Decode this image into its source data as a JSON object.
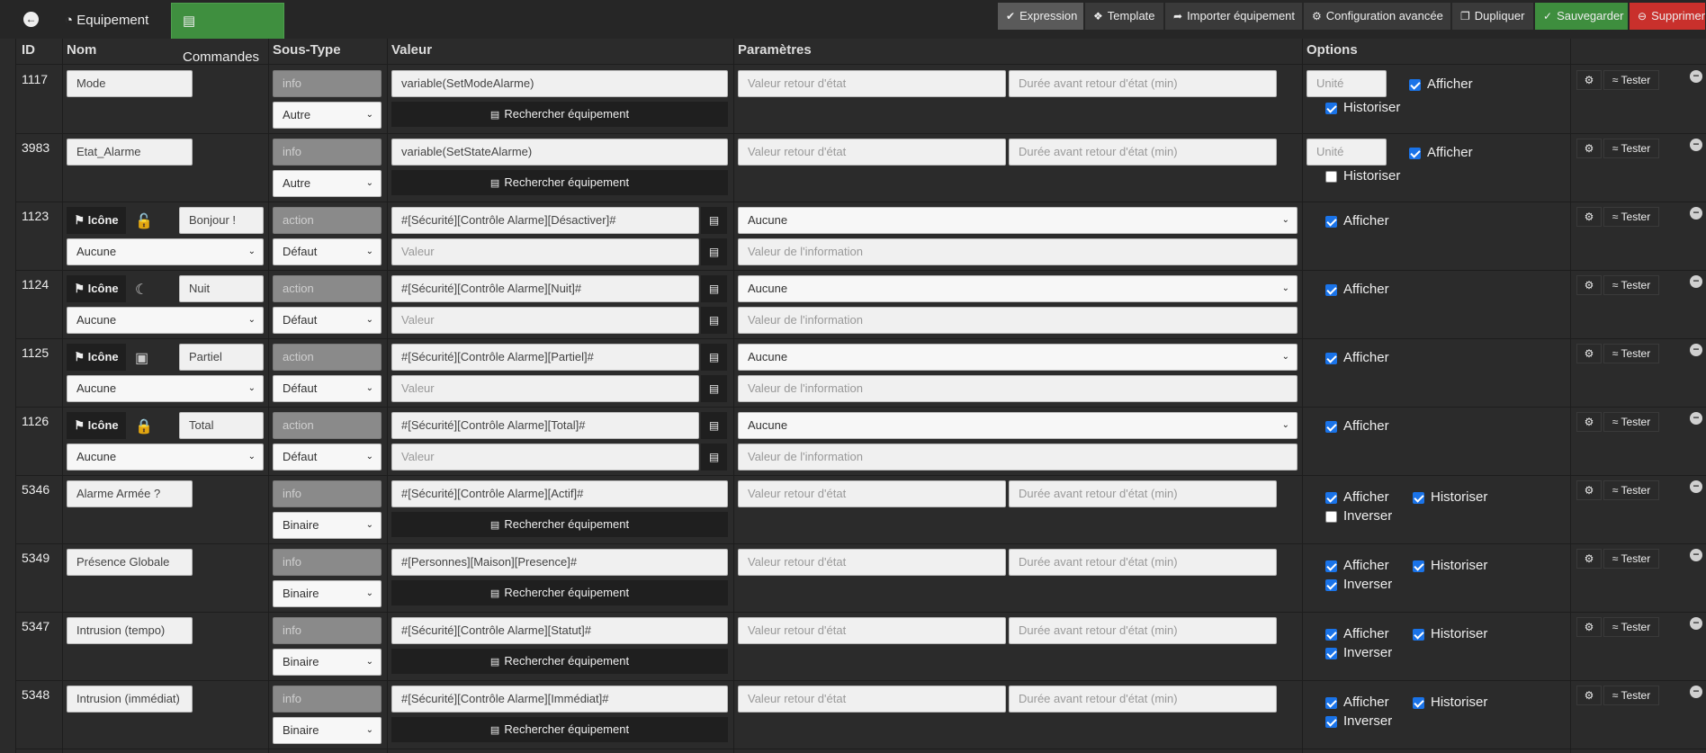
{
  "nav": {
    "tab_equipement": "Equipement",
    "tab_commandes": "Commandes"
  },
  "toolbar": {
    "expression": "Expression",
    "template": "Template",
    "importer": "Importer équipement",
    "config": "Configuration avancée",
    "dupliquer": "Dupliquer",
    "sauvegarder": "Sauvegarder",
    "supprimer": "Supprimer"
  },
  "headers": {
    "id": "ID",
    "nom": "Nom",
    "soustype": "Sous-Type",
    "valeur": "Valeur",
    "parametres": "Paramètres",
    "options": "Options"
  },
  "labels": {
    "rechercher": "Rechercher équipement",
    "icone": "Icône",
    "afficher": "Afficher",
    "historiser": "Historiser",
    "inverser": "Inverser",
    "tester": "Tester"
  },
  "placeholders": {
    "retour": "Valeur retour d'état",
    "duree": "Durée avant retour d'état (min)",
    "unite": "Unité",
    "valeur": "Valeur",
    "valeur_info": "Valeur de l'information"
  },
  "rows": [
    {
      "id": "1117",
      "name": "Mode",
      "type": "info",
      "subtype": "Autre",
      "value": "variable(SetModeAlarme)",
      "afficher": true,
      "historiser": true
    },
    {
      "id": "3983",
      "name": "Etat_Alarme",
      "type": "info",
      "subtype": "Autre",
      "value": "variable(SetStateAlarme)",
      "afficher": true,
      "historiser": false
    },
    {
      "id": "1123",
      "name": "Bonjour !",
      "type": "action",
      "subtype": "Défaut",
      "value": "#[Sécurité][Contrôle Alarme][Désactiver]#",
      "param": "Aucune",
      "generic": "Aucune",
      "afficher": true
    },
    {
      "id": "1124",
      "name": "Nuit",
      "type": "action",
      "subtype": "Défaut",
      "value": "#[Sécurité][Contrôle Alarme][Nuit]#",
      "param": "Aucune",
      "generic": "Aucune",
      "afficher": true
    },
    {
      "id": "1125",
      "name": "Partiel",
      "type": "action",
      "subtype": "Défaut",
      "value": "#[Sécurité][Contrôle Alarme][Partiel]#",
      "param": "Aucune",
      "generic": "Aucune",
      "afficher": true
    },
    {
      "id": "1126",
      "name": "Total",
      "type": "action",
      "subtype": "Défaut",
      "value": "#[Sécurité][Contrôle Alarme][Total]#",
      "param": "Aucune",
      "generic": "Aucune",
      "afficher": true
    },
    {
      "id": "5346",
      "name": "Alarme Armée ?",
      "type": "info",
      "subtype": "Binaire",
      "value": "#[Sécurité][Contrôle Alarme][Actif]#",
      "afficher": true,
      "historiser": true,
      "inverser": false
    },
    {
      "id": "5349",
      "name": "Présence Globale",
      "type": "info",
      "subtype": "Binaire",
      "value": "#[Personnes][Maison][Presence]#",
      "afficher": true,
      "historiser": true,
      "inverser": true
    },
    {
      "id": "5347",
      "name": "Intrusion (tempo)",
      "type": "info",
      "subtype": "Binaire",
      "value": "#[Sécurité][Contrôle Alarme][Statut]#",
      "afficher": true,
      "historiser": true,
      "inverser": true
    },
    {
      "id": "5348",
      "name": "Intrusion (immédiat)",
      "type": "info",
      "subtype": "Binaire",
      "value": "#[Sécurité][Contrôle Alarme][Immédiat]#",
      "afficher": true,
      "historiser": true,
      "inverser": true
    }
  ]
}
